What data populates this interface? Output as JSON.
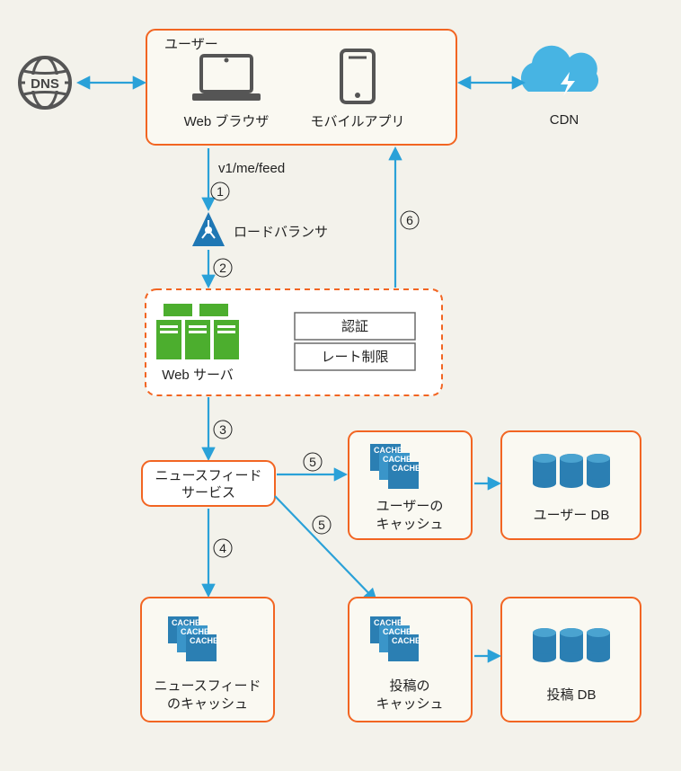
{
  "user_box": {
    "title": "ユーザー",
    "browser": "Web ブラウザ",
    "mobile": "モバイルアプリ"
  },
  "dns": "DNS",
  "cdn": "CDN",
  "api_path": "v1/me/feed",
  "load_balancer": "ロードバランサ",
  "web_server": {
    "label": "Web サーバ",
    "auth": "認証",
    "rate_limit": "レート制限"
  },
  "newsfeed_service": {
    "line1": "ニュースフィード",
    "line2": "サービス"
  },
  "newsfeed_cache": {
    "line1": "ニュースフィード",
    "line2": "のキャッシュ"
  },
  "user_cache": {
    "line1": "ユーザーの",
    "line2": "キャッシュ"
  },
  "user_db": "ユーザー DB",
  "post_cache": {
    "line1": "投稿の",
    "line2": "キャッシュ"
  },
  "post_db": "投稿 DB",
  "cache_word": "CACHE",
  "steps": {
    "s1": "1",
    "s2": "2",
    "s3": "3",
    "s4": "4",
    "s5": "5",
    "s6": "6"
  }
}
